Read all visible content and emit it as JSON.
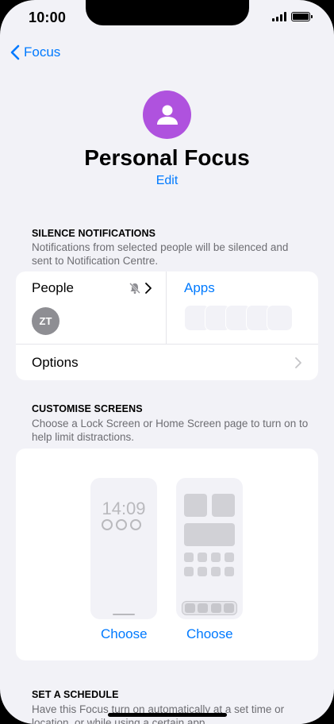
{
  "status_bar": {
    "time": "10:00"
  },
  "nav": {
    "back_label": "Focus"
  },
  "header": {
    "title": "Personal Focus",
    "edit_label": "Edit"
  },
  "silence": {
    "heading": "SILENCE NOTIFICATIONS",
    "description": "Notifications from selected people will be silenced and sent to Notification Centre.",
    "people_label": "People",
    "people_initials": "ZT",
    "apps_label": "Apps",
    "options_label": "Options"
  },
  "customise": {
    "heading": "CUSTOMISE SCREENS",
    "description": "Choose a Lock Screen or Home Screen page to turn on to help limit distractions.",
    "lock_time": "14:09",
    "lock_choose": "Choose",
    "home_choose": "Choose"
  },
  "schedule": {
    "heading": "SET A SCHEDULE",
    "description": "Have this Focus turn on automatically at a set time or location, or while using a certain app."
  },
  "colors": {
    "accent": "#007aff",
    "focus_purple": "#af52de",
    "background": "#f2f2f7"
  },
  "icons": [
    "chevron-left-icon",
    "person-icon",
    "bell-slash-icon",
    "chevron-right-icon",
    "signal-icon",
    "battery-icon"
  ]
}
